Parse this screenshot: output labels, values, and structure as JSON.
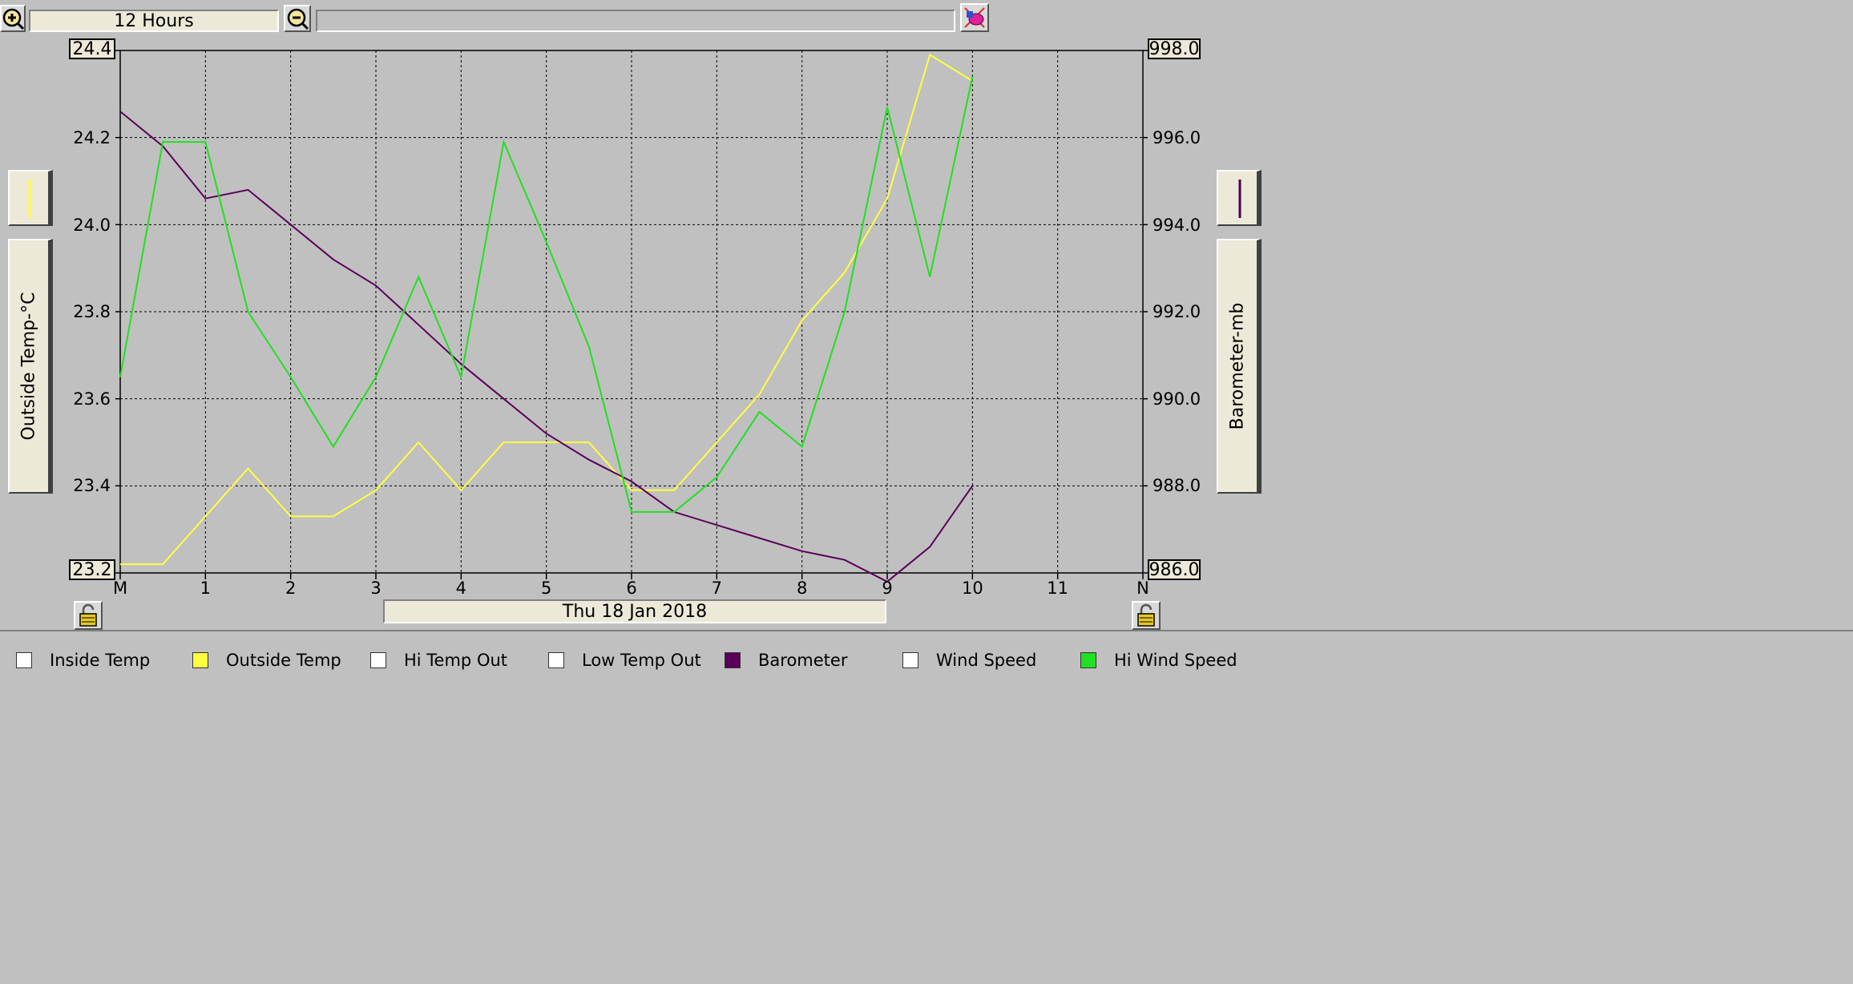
{
  "toolbar": {
    "zoom_in_icon": "zoom-in-icon",
    "zoom_out_icon": "zoom-out-icon",
    "range_label": "12 Hours",
    "search_value": "",
    "clear_icon": "eraser-icon"
  },
  "left_axis": {
    "label": "Outside Temp-°C",
    "top_value": "24.4",
    "bottom_value": "23.2",
    "ticks": [
      "24.2",
      "24.0",
      "23.8",
      "23.6",
      "23.4"
    ],
    "line_color": "#ffff40"
  },
  "right_axis": {
    "label": "Barometer-mb",
    "top_value": "998.0",
    "bottom_value": "986.0",
    "ticks": [
      "996.0",
      "994.0",
      "992.0",
      "990.0",
      "988.0"
    ],
    "line_color": "#4a0050"
  },
  "x_axis": {
    "ticks": [
      "M",
      "1",
      "2",
      "3",
      "4",
      "5",
      "6",
      "7",
      "8",
      "9",
      "10",
      "11",
      "N"
    ],
    "date": "Thu 18 Jan 2018"
  },
  "legend": [
    {
      "label": "Inside Temp",
      "checked": false,
      "color": "#ffffff"
    },
    {
      "label": "Outside Temp",
      "checked": true,
      "color": "#ffff40"
    },
    {
      "label": "Hi Temp Out",
      "checked": false,
      "color": "#ffffff"
    },
    {
      "label": "Low Temp Out",
      "checked": false,
      "color": "#ffffff"
    },
    {
      "label": "Barometer",
      "checked": true,
      "color": "#5a005a"
    },
    {
      "label": "Wind Speed",
      "checked": false,
      "color": "#ffffff"
    },
    {
      "label": "Hi Wind Speed",
      "checked": true,
      "color": "#20e020"
    }
  ],
  "chart_data": {
    "type": "line",
    "x_range": [
      0,
      12
    ],
    "left_ylim": [
      23.2,
      24.4
    ],
    "right_ylim": [
      986.0,
      998.0
    ],
    "grid": true,
    "series": [
      {
        "name": "Outside Temp",
        "axis": "left",
        "color": "#ffff40",
        "x": [
          0,
          0.5,
          1,
          1.5,
          2,
          2.5,
          3,
          3.5,
          4,
          4.5,
          5,
          5.5,
          6,
          6.5,
          7,
          7.5,
          8,
          8.5,
          9,
          9.5,
          10
        ],
        "y": [
          23.22,
          23.22,
          23.33,
          23.44,
          23.33,
          23.33,
          23.39,
          23.5,
          23.39,
          23.5,
          23.5,
          23.5,
          23.39,
          23.39,
          23.5,
          23.61,
          23.78,
          23.89,
          24.06,
          24.39,
          24.33
        ]
      },
      {
        "name": "Barometer",
        "axis": "right",
        "color": "#5a005a",
        "x": [
          0,
          0.5,
          1,
          1.5,
          2,
          2.5,
          3,
          3.5,
          4,
          4.5,
          5,
          5.5,
          6,
          6.5,
          7,
          7.5,
          8,
          8.5,
          9,
          9.5,
          10
        ],
        "y": [
          996.6,
          995.8,
          994.6,
          994.8,
          994.0,
          993.2,
          992.6,
          991.7,
          990.8,
          990.0,
          989.2,
          988.6,
          988.1,
          987.4,
          987.1,
          986.8,
          986.5,
          986.3,
          985.8,
          986.6,
          988.0
        ]
      },
      {
        "name": "Hi Wind Speed",
        "axis": "left",
        "color": "#20e020",
        "x": [
          0,
          0.5,
          1,
          1.5,
          2,
          2.5,
          3,
          3.5,
          4,
          4.5,
          5,
          5.5,
          6,
          6.5,
          7,
          7.5,
          8,
          8.5,
          9,
          9.5,
          10
        ],
        "y": [
          23.65,
          24.19,
          24.19,
          23.8,
          23.65,
          23.49,
          23.65,
          23.88,
          23.65,
          24.19,
          23.96,
          23.72,
          23.34,
          23.34,
          23.42,
          23.57,
          23.49,
          23.8,
          24.27,
          23.88,
          24.34
        ]
      }
    ]
  }
}
